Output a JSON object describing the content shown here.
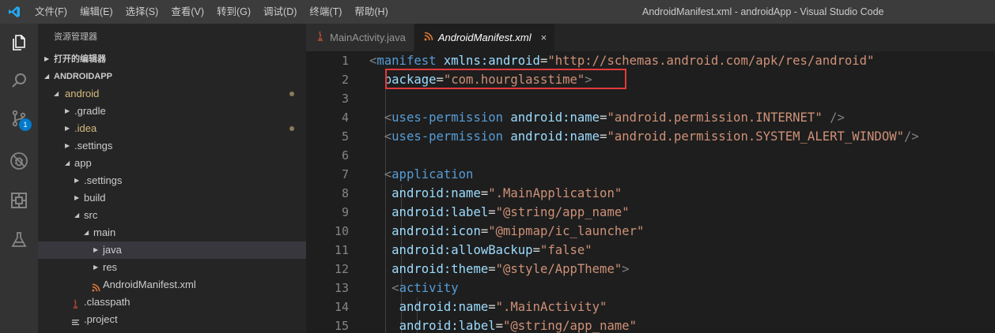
{
  "titlebar": {
    "menu": [
      "文件(F)",
      "编辑(E)",
      "选择(S)",
      "查看(V)",
      "转到(G)",
      "调试(D)",
      "终端(T)",
      "帮助(H)"
    ],
    "window_title": "AndroidManifest.xml - androidApp - Visual Studio Code"
  },
  "activitybar": {
    "items": [
      "files-icon",
      "search-icon",
      "source-control-icon",
      "debug-icon",
      "extensions-icon",
      "test-flask-icon"
    ],
    "scm_badge": "1"
  },
  "sidebar": {
    "title": "资源管理器",
    "open_editors": "打开的编辑器",
    "workspace": "ANDROIDAPP",
    "tree": [
      {
        "label": "android",
        "modified": true
      },
      {
        "label": ".gradle"
      },
      {
        "label": ".idea",
        "modified": true
      },
      {
        "label": ".settings"
      },
      {
        "label": "app"
      },
      {
        "label": ".settings"
      },
      {
        "label": "build"
      },
      {
        "label": "src"
      },
      {
        "label": "main"
      },
      {
        "label": "java",
        "selected": true
      },
      {
        "label": "res"
      },
      {
        "label": "AndroidManifest.xml"
      },
      {
        "label": ".classpath"
      },
      {
        "label": ".project"
      }
    ]
  },
  "tabs": [
    {
      "label": "MainActivity.java",
      "active": false
    },
    {
      "label": "AndroidManifest.xml",
      "active": true,
      "close": "×"
    }
  ],
  "editor": {
    "line_numbers": [
      "1",
      "2",
      "3",
      "4",
      "5",
      "6",
      "7",
      "8",
      "9",
      "10",
      "11",
      "12",
      "13",
      "14",
      "15"
    ],
    "lines": [
      [
        [
          "punct",
          "<"
        ],
        [
          "tag",
          "manifest"
        ],
        [
          "plain",
          " "
        ],
        [
          "attr",
          "xmlns:android"
        ],
        [
          "plain",
          "="
        ],
        [
          "val",
          "\"http://schemas.android.com/apk/res/android\""
        ]
      ],
      [
        [
          "plain",
          "  "
        ],
        [
          "attr",
          "package"
        ],
        [
          "plain",
          "="
        ],
        [
          "val",
          "\"com.hourglasstime\""
        ],
        [
          "punct",
          ">"
        ]
      ],
      [],
      [
        [
          "plain",
          "  "
        ],
        [
          "punct",
          "<"
        ],
        [
          "tag",
          "uses-permission"
        ],
        [
          "plain",
          " "
        ],
        [
          "attr",
          "android:name"
        ],
        [
          "plain",
          "="
        ],
        [
          "val",
          "\"android.permission.INTERNET\""
        ],
        [
          "plain",
          " "
        ],
        [
          "punct",
          "/>"
        ]
      ],
      [
        [
          "plain",
          "  "
        ],
        [
          "punct",
          "<"
        ],
        [
          "tag",
          "uses-permission"
        ],
        [
          "plain",
          " "
        ],
        [
          "attr",
          "android:name"
        ],
        [
          "plain",
          "="
        ],
        [
          "val",
          "\"android.permission.SYSTEM_ALERT_WINDOW\""
        ],
        [
          "punct",
          "/>"
        ]
      ],
      [],
      [
        [
          "plain",
          "  "
        ],
        [
          "punct",
          "<"
        ],
        [
          "tag",
          "application"
        ]
      ],
      [
        [
          "plain",
          "   "
        ],
        [
          "attr",
          "android:name"
        ],
        [
          "plain",
          "="
        ],
        [
          "val",
          "\".MainApplication\""
        ]
      ],
      [
        [
          "plain",
          "   "
        ],
        [
          "attr",
          "android:label"
        ],
        [
          "plain",
          "="
        ],
        [
          "val",
          "\"@string/app_name\""
        ]
      ],
      [
        [
          "plain",
          "   "
        ],
        [
          "attr",
          "android:icon"
        ],
        [
          "plain",
          "="
        ],
        [
          "val",
          "\"@mipmap/ic_launcher\""
        ]
      ],
      [
        [
          "plain",
          "   "
        ],
        [
          "attr",
          "android:allowBackup"
        ],
        [
          "plain",
          "="
        ],
        [
          "val",
          "\"false\""
        ]
      ],
      [
        [
          "plain",
          "   "
        ],
        [
          "attr",
          "android:theme"
        ],
        [
          "plain",
          "="
        ],
        [
          "val",
          "\"@style/AppTheme\""
        ],
        [
          "punct",
          ">"
        ]
      ],
      [
        [
          "plain",
          "   "
        ],
        [
          "punct",
          "<"
        ],
        [
          "tag",
          "activity"
        ]
      ],
      [
        [
          "plain",
          "    "
        ],
        [
          "attr",
          "android:name"
        ],
        [
          "plain",
          "="
        ],
        [
          "val",
          "\".MainActivity\""
        ]
      ],
      [
        [
          "plain",
          "    "
        ],
        [
          "attr",
          "android:label"
        ],
        [
          "plain",
          "="
        ],
        [
          "val",
          "\"@string/app_name\""
        ]
      ]
    ]
  },
  "colors": {
    "highlight_box": "#e23a3a",
    "badge": "#007acc",
    "modified_dot": "#8c7a58"
  }
}
